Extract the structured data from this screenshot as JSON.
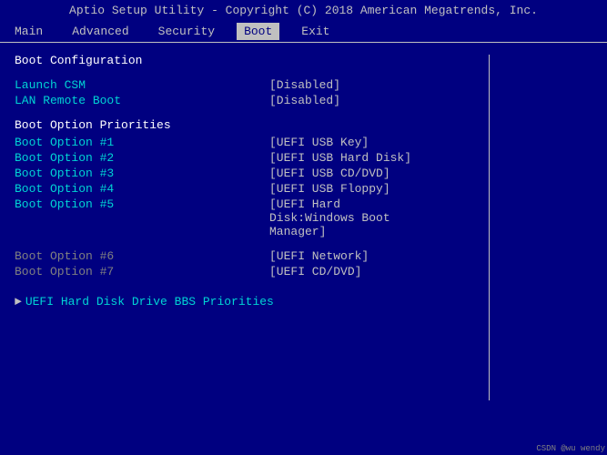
{
  "title": {
    "text": "Aptio Setup Utility - Copyright (C) 2018 American Megatrends, Inc."
  },
  "menu": {
    "items": [
      {
        "label": "Main",
        "active": false
      },
      {
        "label": "Advanced",
        "active": false
      },
      {
        "label": "Security",
        "active": false
      },
      {
        "label": "Boot",
        "active": true
      },
      {
        "label": "Exit",
        "active": false
      }
    ]
  },
  "content": {
    "section_title": "Boot Configuration",
    "rows": [
      {
        "label": "Launch CSM",
        "value": "[Disabled]",
        "label_style": "cyan"
      },
      {
        "label": "LAN Remote Boot",
        "value": "[Disabled]",
        "label_style": "cyan"
      }
    ],
    "priorities_title": "Boot Option Priorities",
    "priorities": [
      {
        "label": "Boot Option #1",
        "value": "[UEFI USB Key]",
        "label_style": "cyan"
      },
      {
        "label": "Boot Option #2",
        "value": "[UEFI USB Hard Disk]",
        "label_style": "cyan"
      },
      {
        "label": "Boot Option #3",
        "value": "[UEFI USB CD/DVD]",
        "label_style": "cyan"
      },
      {
        "label": "Boot Option #4",
        "value": "[UEFI USB Floppy]",
        "label_style": "cyan"
      },
      {
        "label": "Boot Option #5",
        "value": "[UEFI Hard Disk:Windows Boot Manager]",
        "label_style": "cyan"
      },
      {
        "label": "Boot Option #6",
        "value": "[UEFI Network]",
        "label_style": "gray"
      },
      {
        "label": "Boot Option #7",
        "value": "[UEFI CD/DVD]",
        "label_style": "gray"
      }
    ],
    "sub_menu": {
      "label": "UEFI Hard Disk Drive BBS Priorities",
      "style": "cyan"
    }
  },
  "watermark": "CSDN @wu wendy"
}
